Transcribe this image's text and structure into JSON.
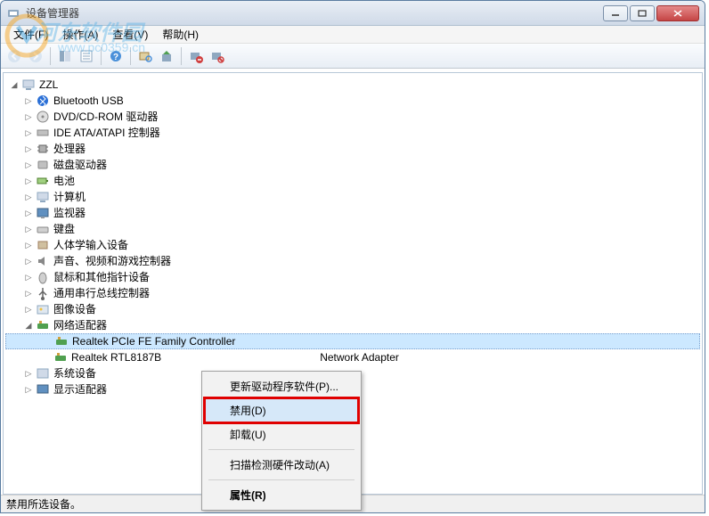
{
  "window": {
    "title": "设备管理器"
  },
  "menubar": {
    "file": "文件(F)",
    "action": "操作(A)",
    "view": "查看(V)",
    "help": "帮助(H)"
  },
  "tree": {
    "root": "ZZL",
    "items": [
      {
        "label": "Bluetooth USB",
        "icon": "bluetooth"
      },
      {
        "label": "DVD/CD-ROM 驱动器",
        "icon": "disc"
      },
      {
        "label": "IDE ATA/ATAPI 控制器",
        "icon": "ide"
      },
      {
        "label": "处理器",
        "icon": "cpu"
      },
      {
        "label": "磁盘驱动器",
        "icon": "disk"
      },
      {
        "label": "电池",
        "icon": "battery"
      },
      {
        "label": "计算机",
        "icon": "computer"
      },
      {
        "label": "监视器",
        "icon": "monitor"
      },
      {
        "label": "键盘",
        "icon": "keyboard"
      },
      {
        "label": "人体学输入设备",
        "icon": "hid"
      },
      {
        "label": "声音、视频和游戏控制器",
        "icon": "sound"
      },
      {
        "label": "鼠标和其他指针设备",
        "icon": "mouse"
      },
      {
        "label": "通用串行总线控制器",
        "icon": "usb"
      },
      {
        "label": "图像设备",
        "icon": "image"
      }
    ],
    "network": {
      "label": "网络适配器",
      "children": [
        {
          "label": "Realtek PCIe FE Family Controller",
          "selected": true
        },
        {
          "label_prefix": "Realtek RTL8187B ",
          "label_suffix": " Network Adapter"
        }
      ]
    },
    "after": [
      {
        "label": "系统设备",
        "icon": "system"
      },
      {
        "label": "显示适配器",
        "icon": "display"
      }
    ]
  },
  "context_menu": {
    "update_driver": "更新驱动程序软件(P)...",
    "disable": "禁用(D)",
    "uninstall": "卸载(U)",
    "scan": "扫描检测硬件改动(A)",
    "properties": "属性(R)"
  },
  "statusbar": {
    "text": "禁用所选设备。"
  },
  "watermark": {
    "text": "河东软件园",
    "url": "www.pc0359.cn"
  }
}
